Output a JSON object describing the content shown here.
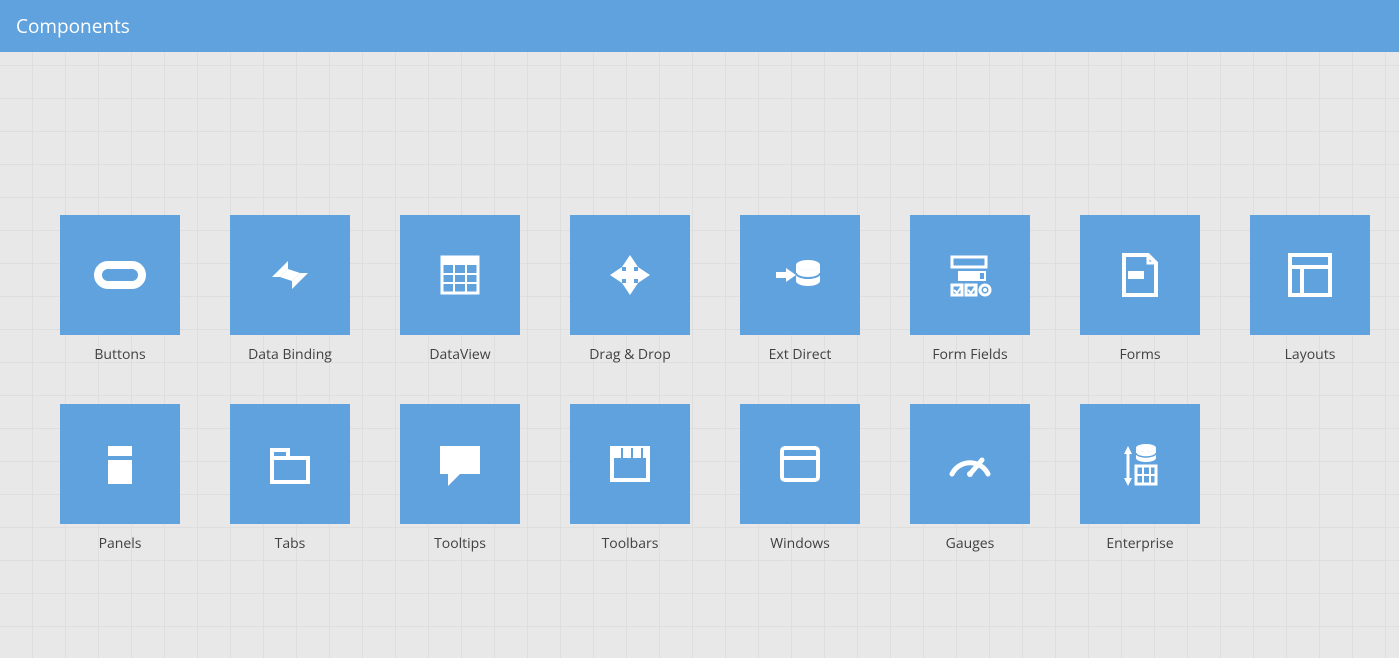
{
  "header": {
    "title": "Components"
  },
  "tiles": [
    {
      "label": "Buttons",
      "icon": "buttons"
    },
    {
      "label": "Data Binding",
      "icon": "data-binding"
    },
    {
      "label": "DataView",
      "icon": "dataview"
    },
    {
      "label": "Drag & Drop",
      "icon": "drag-drop"
    },
    {
      "label": "Ext Direct",
      "icon": "ext-direct"
    },
    {
      "label": "Form Fields",
      "icon": "form-fields"
    },
    {
      "label": "Forms",
      "icon": "forms"
    },
    {
      "label": "Layouts",
      "icon": "layouts"
    },
    {
      "label": "Panels",
      "icon": "panels"
    },
    {
      "label": "Tabs",
      "icon": "tabs"
    },
    {
      "label": "Tooltips",
      "icon": "tooltips"
    },
    {
      "label": "Toolbars",
      "icon": "toolbars"
    },
    {
      "label": "Windows",
      "icon": "windows"
    },
    {
      "label": "Gauges",
      "icon": "gauges"
    },
    {
      "label": "Enterprise",
      "icon": "enterprise"
    }
  ],
  "colors": {
    "brand": "#5fa2dd",
    "icon": "#ffffff"
  }
}
